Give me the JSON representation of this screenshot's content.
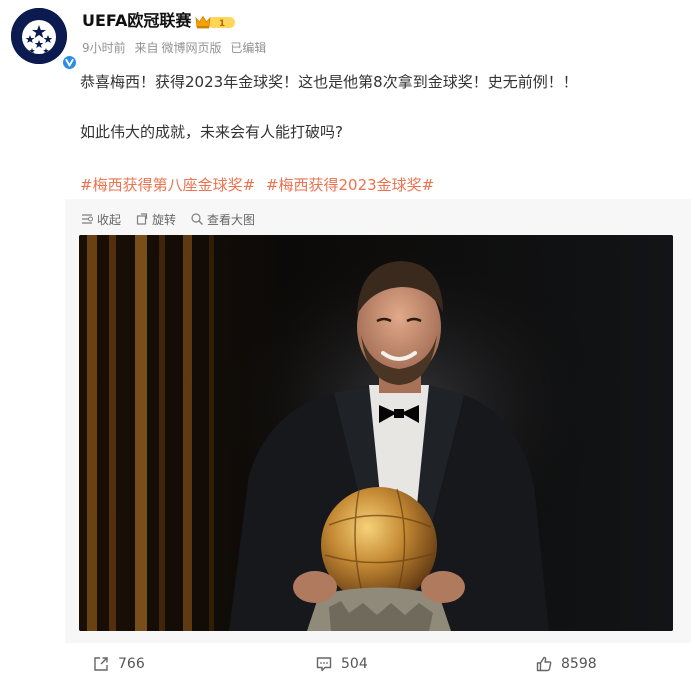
{
  "user": {
    "name": "UEFA欧冠联赛",
    "member_level": "1",
    "avatar_icon": "champions-league-starball-icon",
    "verified_icon": "verified-v-icon"
  },
  "meta": {
    "time": "9小时前",
    "source_prefix": "来自",
    "source": "微博网页版",
    "edited": "已编辑"
  },
  "post": {
    "line1": "恭喜梅西！获得2023年金球奖！这也是他第8次拿到金球奖！史无前例！！",
    "line2": "如此伟大的成就，未来会有人能打破吗?",
    "tags": [
      "#梅西获得第八座金球奖#",
      "#梅西获得2023金球奖#"
    ]
  },
  "media": {
    "tools": [
      {
        "label": "收起",
        "icon": "collapse-icon"
      },
      {
        "label": "旋转",
        "icon": "rotate-icon"
      },
      {
        "label": "查看大图",
        "icon": "magnify-icon"
      }
    ]
  },
  "footer": {
    "repost_count": "766",
    "comment_count": "504",
    "like_count": "8598"
  },
  "colors": {
    "tag": "#eb7350",
    "meta": "#939393",
    "panel": "#f7f7f7",
    "avatar_bg": "#0b1a4f",
    "verified": "#ffa726"
  }
}
